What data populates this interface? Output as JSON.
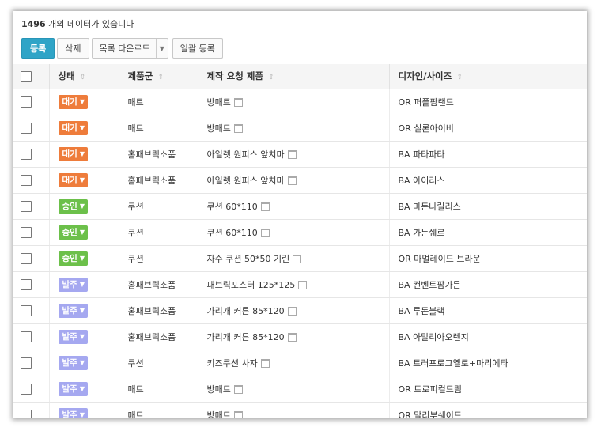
{
  "header": {
    "count_number": "1496",
    "count_suffix": " 개의 데이터가 있습니다"
  },
  "toolbar": {
    "register_label": "등록",
    "delete_label": "삭제",
    "download_label": "목록 다운로드",
    "bulk_register_label": "일괄 등록"
  },
  "table": {
    "columns": [
      "상태",
      "제품군",
      "제작 요청 제품",
      "디자인/사이즈"
    ],
    "rows": [
      {
        "status": "대기",
        "kind": "wait",
        "group": "매트",
        "product": "방매트",
        "design": "OR 퍼플팜랜드"
      },
      {
        "status": "대기",
        "kind": "wait",
        "group": "매트",
        "product": "방매트",
        "design": "OR 실론아이비"
      },
      {
        "status": "대기",
        "kind": "wait",
        "group": "홈패브릭소품",
        "product": "아일렛 원피스 앞치마",
        "design": "BA 파타파타"
      },
      {
        "status": "대기",
        "kind": "wait",
        "group": "홈패브릭소품",
        "product": "아일렛 원피스 앞치마",
        "design": "BA 아이리스"
      },
      {
        "status": "승인",
        "kind": "ok",
        "group": "쿠션",
        "product": "쿠션 60*110",
        "design": "BA 마돈나릴리스"
      },
      {
        "status": "승인",
        "kind": "ok",
        "group": "쿠션",
        "product": "쿠션 60*110",
        "design": "BA 가든쉐르"
      },
      {
        "status": "승인",
        "kind": "ok",
        "group": "쿠션",
        "product": "자수 쿠션 50*50 기린",
        "design": "OR 마멀레이드 브라운"
      },
      {
        "status": "발주",
        "kind": "order",
        "group": "홈패브릭소품",
        "product": "패브릭포스터 125*125",
        "design": "BA 컨벤트팜가든"
      },
      {
        "status": "발주",
        "kind": "order",
        "group": "홈패브릭소품",
        "product": "가리개 커튼 85*120",
        "design": "BA 루돈블랙"
      },
      {
        "status": "발주",
        "kind": "order",
        "group": "홈패브릭소품",
        "product": "가리개 커튼 85*120",
        "design": "BA 아말리아오렌지"
      },
      {
        "status": "발주",
        "kind": "order",
        "group": "쿠션",
        "product": "키즈쿠션 사자",
        "design": "BA 트러프로그옐로+마리에타"
      },
      {
        "status": "발주",
        "kind": "order",
        "group": "매트",
        "product": "방매트",
        "design": "OR 트로피컬드림"
      },
      {
        "status": "발주",
        "kind": "order",
        "group": "매트",
        "product": "방매트",
        "design": "OR 말리부쉐이드"
      }
    ]
  },
  "colors": {
    "primary": "#2fa4c7",
    "wait": "#ee7c3b",
    "ok": "#6cc04a",
    "order": "#a5a8f0"
  },
  "icons": {
    "sort": "sort-icon",
    "memo": "memo-icon",
    "dropdown": "chevron-down-icon"
  }
}
